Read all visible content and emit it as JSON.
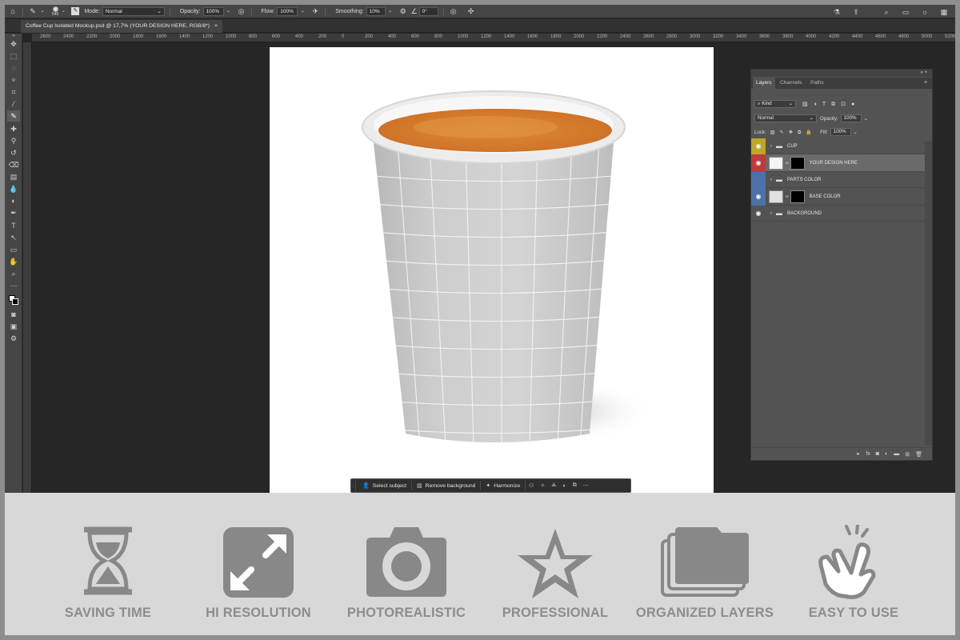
{
  "options_bar": {
    "brush_size": "545",
    "mode_label": "Mode:",
    "mode_value": "Normal",
    "opacity_label": "Opacity:",
    "opacity_value": "100%",
    "flow_label": "Flow:",
    "flow_value": "100%",
    "smoothing_label": "Smoothing:",
    "smoothing_value": "10%",
    "angle_value": "0°"
  },
  "document": {
    "tab_title": "Coffee Cup Isolated Mockup.psd @ 17,7% (YOUR DESIGN HERE, RGB/8*)",
    "tab_close": "×"
  },
  "ruler": {
    "ticks": [
      "2600",
      "2400",
      "2200",
      "2000",
      "1800",
      "1600",
      "1400",
      "1200",
      "1000",
      "800",
      "600",
      "400",
      "200",
      "0",
      "200",
      "400",
      "600",
      "800",
      "1000",
      "1200",
      "1400",
      "1600",
      "1800",
      "2000",
      "2200",
      "2400",
      "2600",
      "2800",
      "3000",
      "3200",
      "3400",
      "3600",
      "3800",
      "4000",
      "4200",
      "4400",
      "4600",
      "4800",
      "5000",
      "5200"
    ]
  },
  "layers_panel": {
    "tabs": [
      "Layers",
      "Channels",
      "Paths"
    ],
    "filter_kind": "Kind",
    "blend_mode": "Normal",
    "opacity_label": "Opacity:",
    "opacity_value": "100%",
    "lock_label": "Lock:",
    "fill_label": "Fill:",
    "fill_value": "100%",
    "layers": [
      {
        "name": "CUP",
        "type": "group",
        "color": "#bfa52a",
        "visible": true
      },
      {
        "name": "YOUR DESIGN HERE",
        "type": "smart-object",
        "color": "#c0393b",
        "visible": true,
        "selected": true
      },
      {
        "name": "PARTS COLOR",
        "type": "group",
        "color": "#4a72a8",
        "visible": false
      },
      {
        "name": "BASE COLOR",
        "type": "layer",
        "color": "#4a72a8",
        "visible": true
      },
      {
        "name": "BACKGROUND",
        "type": "group",
        "color": "",
        "visible": true
      }
    ]
  },
  "context_bar": {
    "select_subject": "Select subject",
    "remove_background": "Remove background",
    "harmonize": "Harmonize"
  },
  "features": [
    {
      "label": "SAVING TIME",
      "icon": "hourglass-icon"
    },
    {
      "label": "HI RESOLUTION",
      "icon": "expand-arrows-icon"
    },
    {
      "label": "PHOTOREALISTIC",
      "icon": "camera-icon"
    },
    {
      "label": "PROFESSIONAL",
      "icon": "star-icon"
    },
    {
      "label": "ORGANIZED LAYERS",
      "icon": "stacked-folders-icon"
    },
    {
      "label": "EASY TO USE",
      "icon": "tap-hand-icon"
    }
  ],
  "colors": {
    "ui_dark": "#262626",
    "panel": "#535353",
    "feature_bg": "#d8d8d8",
    "feature_icon": "#8a8a8a",
    "coffee": "#d9812c",
    "cup": "#cfcfcf"
  }
}
